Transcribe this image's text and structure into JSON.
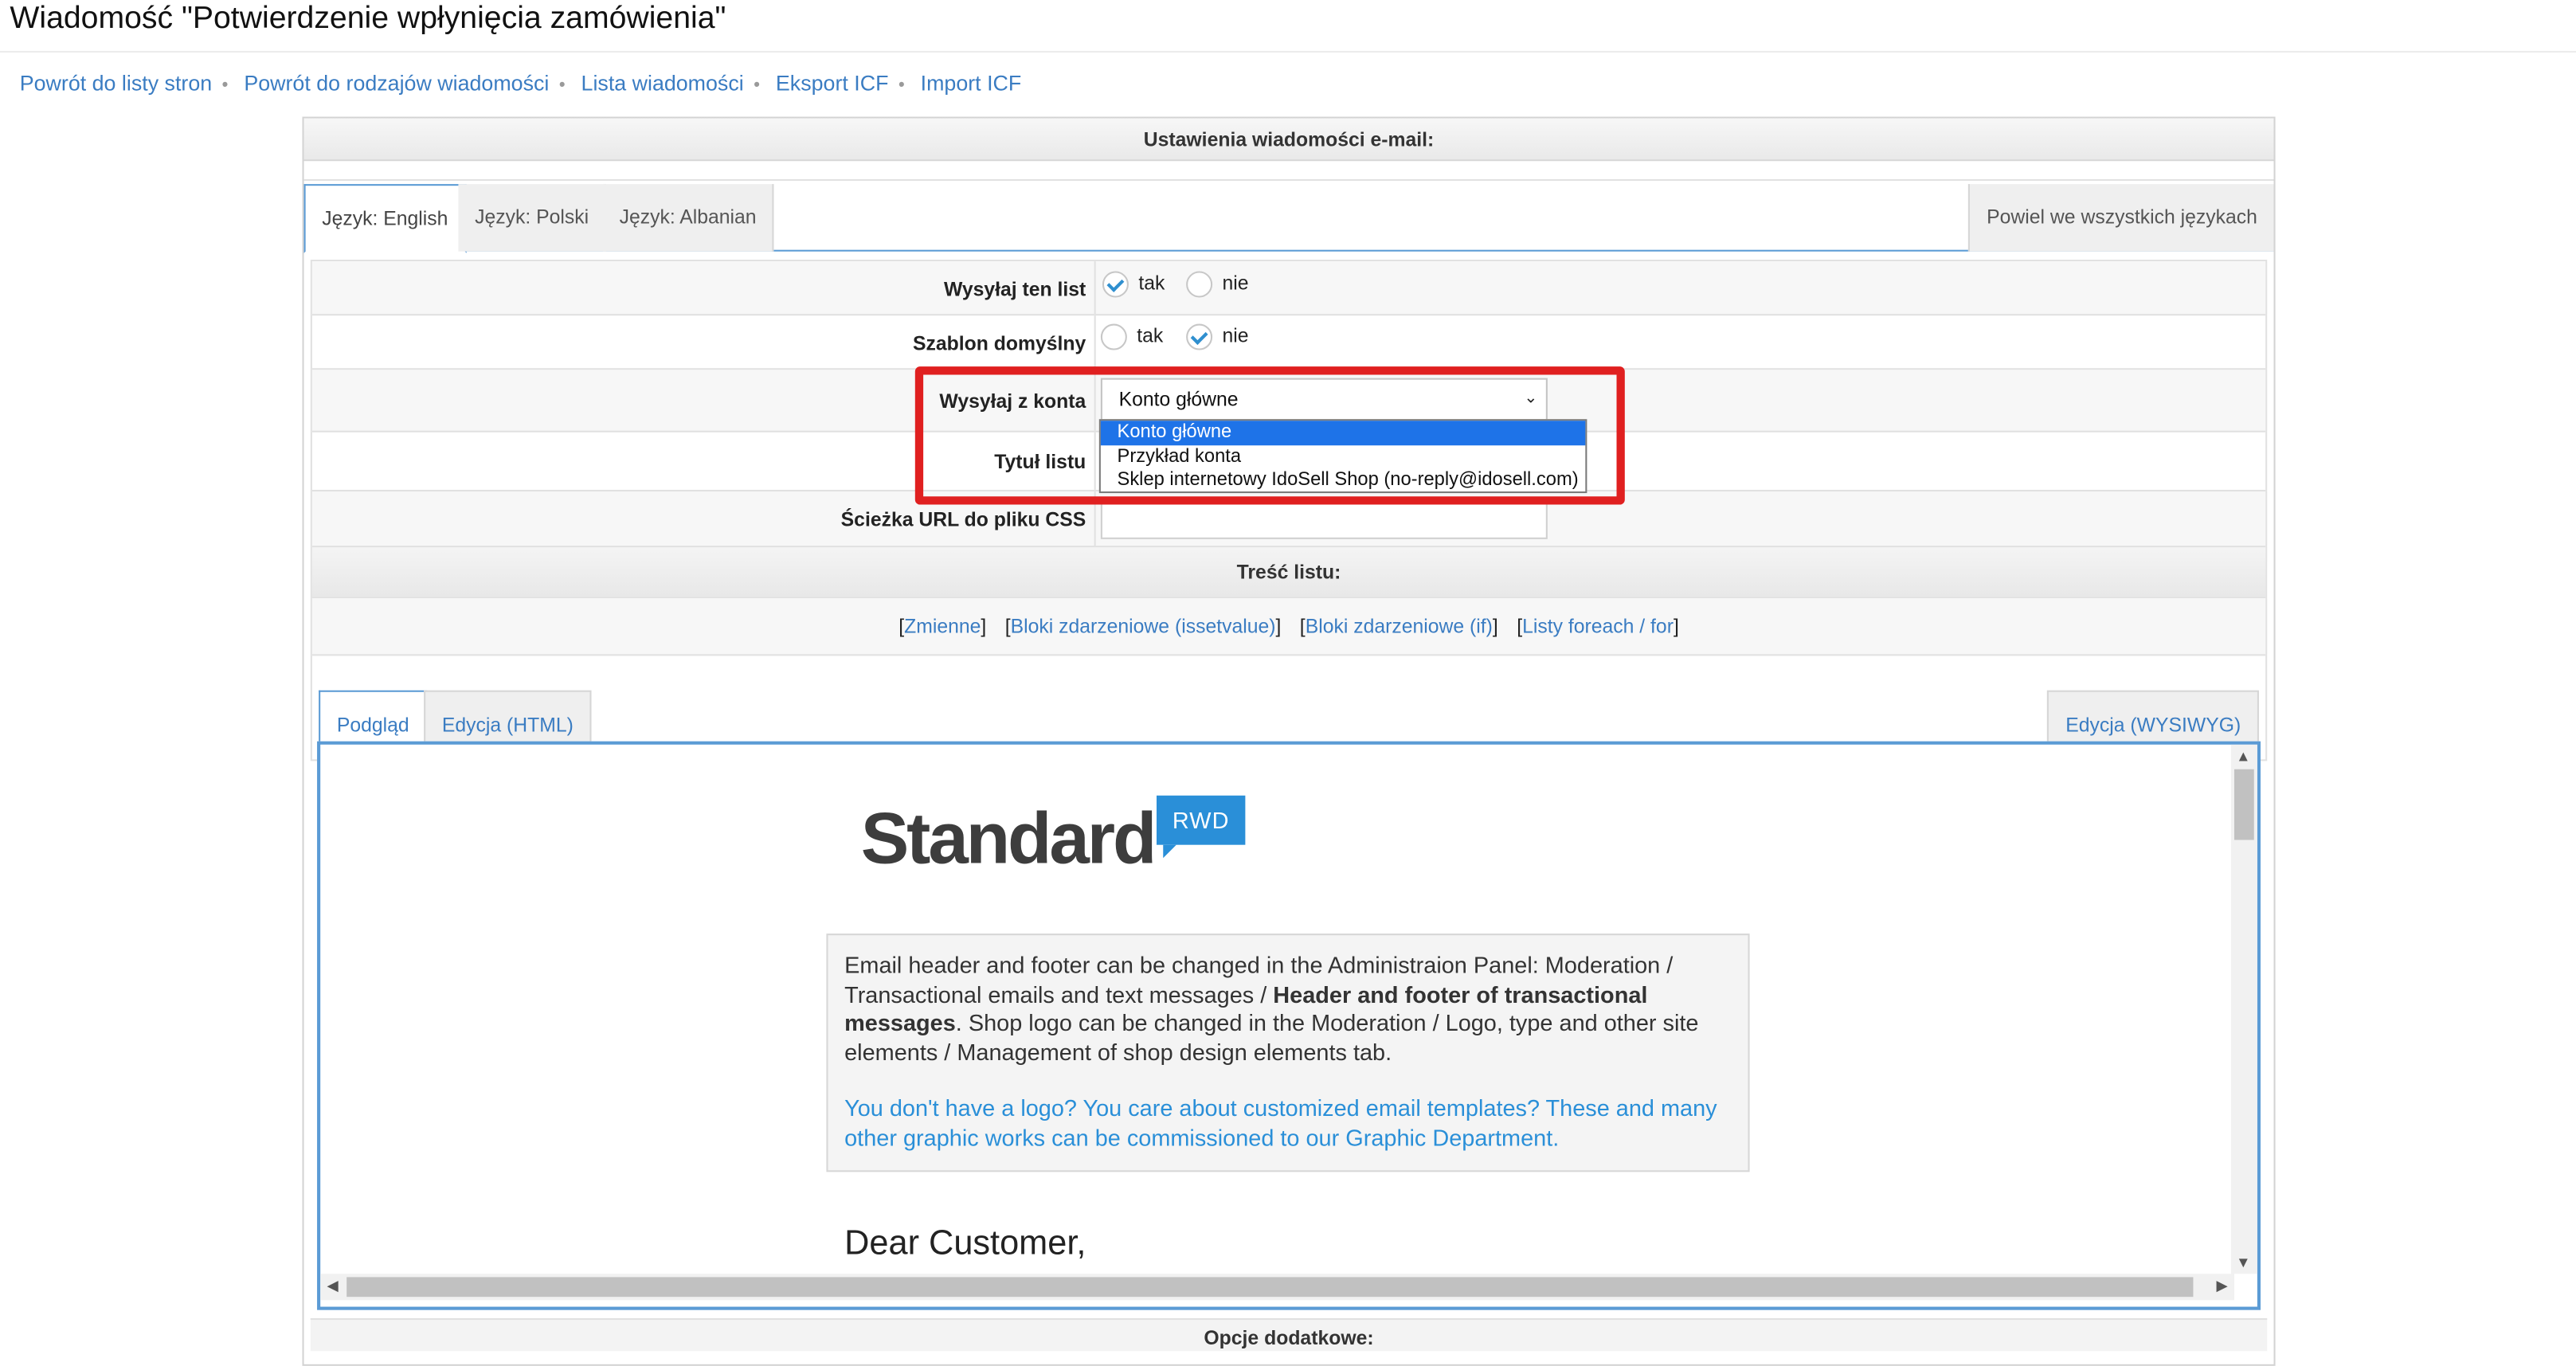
{
  "page": {
    "title": "Wiadomość \"Potwierdzenie wpłynięcia zamówienia\""
  },
  "nav": {
    "links": [
      "Powrót do listy stron",
      "Powrót do rodzajów wiadomości",
      "Lista wiadomości",
      "Eksport ICF",
      "Import ICF"
    ],
    "separator": "•"
  },
  "settings": {
    "header": "Ustawienia wiadomości e-mail:",
    "language_tabs": [
      "Język: English",
      "Język: Polski",
      "Język: Albanian"
    ],
    "active_language_tab": "Język: English",
    "duplicate_button": "Powiel we wszystkich językach"
  },
  "form": {
    "send_this": {
      "label": "Wysyłaj ten list",
      "options": [
        "tak",
        "nie"
      ],
      "selected": "tak"
    },
    "default_template": {
      "label": "Szablon domyślny",
      "options": [
        "tak",
        "nie"
      ],
      "selected": "nie"
    },
    "send_from": {
      "label": "Wysyłaj z konta",
      "value": "Konto główne",
      "options": [
        "Konto główne",
        "Przykład konta",
        "Sklep internetowy IdoSell Shop (no-reply@idosell.com)"
      ],
      "highlighted": "Konto główne"
    },
    "subject": {
      "label": "Tytuł listu",
      "value": ""
    },
    "css_path": {
      "label": "Ścieżka URL do pliku CSS",
      "value": ""
    }
  },
  "content": {
    "header": "Treść listu:",
    "var_links": [
      "Zmienne",
      "Bloki zdarzeniowe (issetvalue)",
      "Bloki zdarzeniowe (if)",
      "Listy foreach / for"
    ],
    "edit_tabs": [
      "Podgląd",
      "Edycja (HTML)"
    ],
    "active_edit_tab": "Podgląd",
    "wysiwyg_tab": "Edycja (WYSIWYG)"
  },
  "preview": {
    "logo_text": "Standard",
    "logo_badge": "RWD",
    "info_text_1": "Email header and footer can be changed in the Administraion Panel: Moderation / Transactional emails and text messages / ",
    "info_text_bold": "Header and footer of transactional messages",
    "info_text_2": ". Shop logo can be changed in the Moderation / Logo, type and other site elements / Management of shop design elements tab.",
    "info_link": "You don't have a logo? You care about customized email templates? These and many other graphic works can be commissioned to our Graphic Department.",
    "greeting": "Dear Customer,"
  },
  "additional": {
    "header": "Opcje dodatkowe:"
  },
  "colors": {
    "link": "#3a7cc2",
    "tab_border": "#5b9bd5",
    "highlight": "#e02020",
    "selected_option": "#1e73e8",
    "check": "#2f8fcf"
  },
  "icons": [
    "check-radio-icon",
    "chevron-down-icon",
    "scroll-up-icon",
    "scroll-down-icon",
    "scroll-left-icon",
    "scroll-right-icon"
  ]
}
